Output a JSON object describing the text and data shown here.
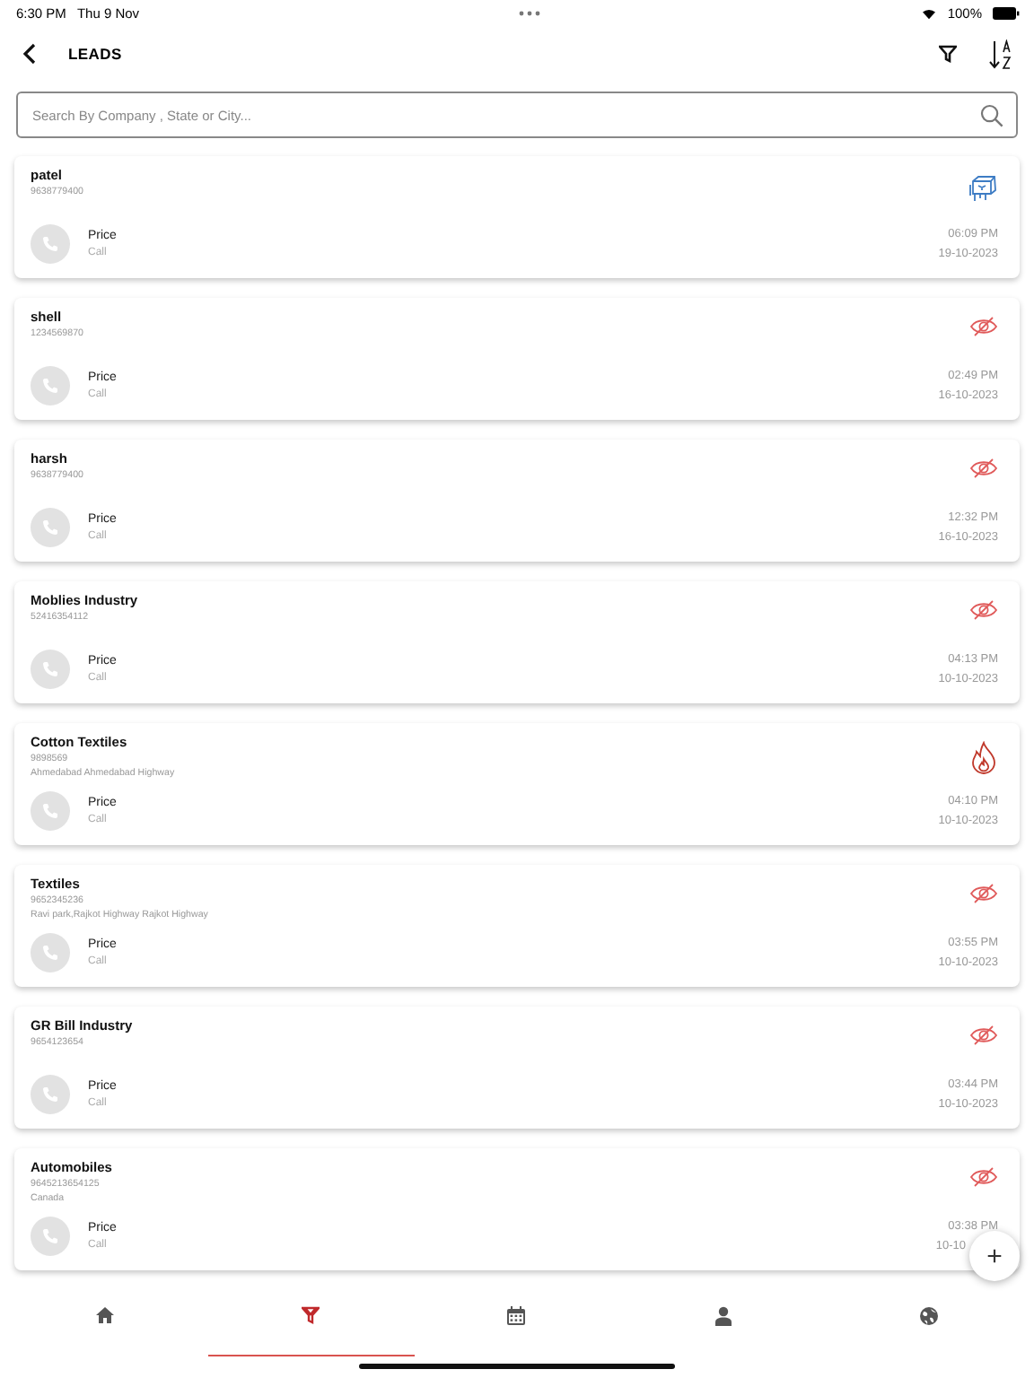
{
  "status_bar": {
    "time": "6:30 PM",
    "date": "Thu 9 Nov",
    "battery": "100%"
  },
  "header": {
    "title": "LEADS"
  },
  "search": {
    "placeholder": "Search By Company , State or City..."
  },
  "leads": [
    {
      "name": "patel",
      "phone": "9638779400",
      "kind": "cold",
      "action": "Price",
      "channel": "Call",
      "time": "06:09 PM",
      "date": "19-10-2023"
    },
    {
      "name": "shell",
      "phone": "1234569870",
      "kind": "hidden",
      "action": "Price",
      "channel": "Call",
      "time": "02:49 PM",
      "date": "16-10-2023"
    },
    {
      "name": "harsh",
      "phone": "9638779400",
      "kind": "hidden",
      "action": "Price",
      "channel": "Call",
      "time": "12:32 PM",
      "date": "16-10-2023"
    },
    {
      "name": "Moblies Industry",
      "phone": "52416354112",
      "kind": "hidden",
      "action": "Price",
      "channel": "Call",
      "time": "04:13 PM",
      "date": "10-10-2023"
    },
    {
      "name": "Cotton Textiles",
      "phone": "9898569",
      "address": "Ahmedabad Ahmedabad Highway",
      "kind": "hot",
      "action": "Price",
      "channel": "Call",
      "time": "04:10 PM",
      "date": "10-10-2023"
    },
    {
      "name": "Textiles",
      "phone": "9652345236",
      "address": "Ravi park,Rajkot Highway Rajkot Highway",
      "kind": "hidden",
      "action": "Price",
      "channel": "Call",
      "time": "03:55 PM",
      "date": "10-10-2023"
    },
    {
      "name": "GR Bill Industry",
      "phone": "9654123654",
      "kind": "hidden",
      "action": "Price",
      "channel": "Call",
      "time": "03:44 PM",
      "date": "10-10-2023"
    },
    {
      "name": "Automobiles",
      "phone": "9645213654125",
      "address": "Canada",
      "kind": "hidden",
      "action": "Price",
      "channel": "Call",
      "time": "03:38 PM",
      "date": "10-10"
    }
  ],
  "fab": {
    "label": "+"
  },
  "nav": [
    {
      "kind": "home",
      "selected": false
    },
    {
      "kind": "funnel",
      "selected": true
    },
    {
      "kind": "calendar",
      "selected": false
    },
    {
      "kind": "person",
      "selected": false
    },
    {
      "kind": "globe",
      "selected": false
    }
  ]
}
